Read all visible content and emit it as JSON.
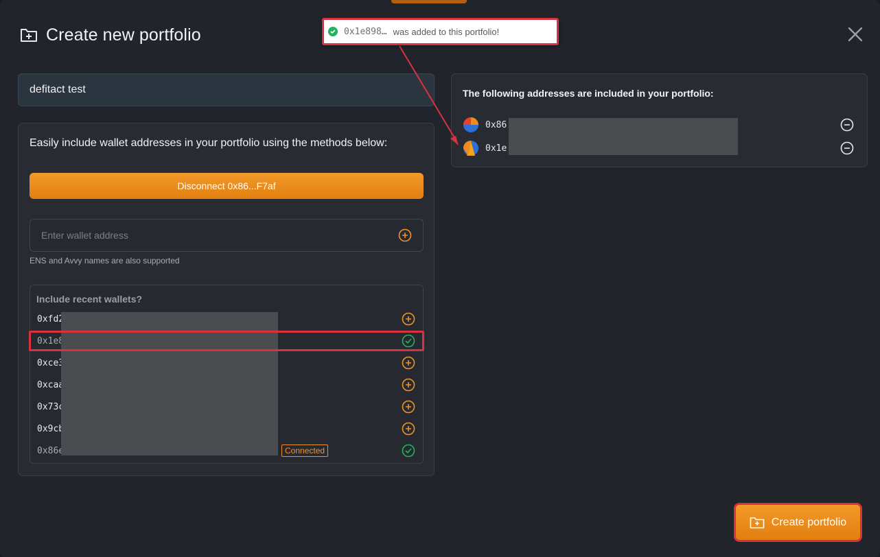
{
  "header": {
    "title": "Create new portfolio",
    "icon": "folder-plus-icon"
  },
  "toast": {
    "address": "0x1e898…",
    "message": "was added to this portfolio!",
    "status_color": "#22b35f"
  },
  "portfolio_name": {
    "value": "defitact test"
  },
  "left": {
    "heading": "Easily include wallet addresses in your portfolio using the methods below:",
    "disconnect_label": "Disconnect 0x86...F7af",
    "wallet_input": {
      "placeholder": "Enter wallet address",
      "value": ""
    },
    "ens_hint": "ENS and Avvy names are also supported",
    "recent": {
      "title": "Include recent wallets?",
      "rows": [
        {
          "address": "0xfd2",
          "state": "add"
        },
        {
          "address": "0x1e8",
          "state": "added"
        },
        {
          "address": "0xce3",
          "state": "add"
        },
        {
          "address": "0xcaa",
          "state": "add"
        },
        {
          "address": "0x73c",
          "state": "add"
        },
        {
          "address": "0x9cb",
          "state": "add"
        },
        {
          "address": "0x86e",
          "state": "added",
          "badge": "Connected"
        }
      ]
    }
  },
  "right": {
    "heading": "The following addresses are included in your portfolio:",
    "addresses": [
      {
        "address": "0x86"
      },
      {
        "address": "0x1e"
      }
    ]
  },
  "create_button": {
    "label": "Create portfolio"
  },
  "colors": {
    "accent": "#f0922a",
    "highlight": "#d8323f",
    "success": "#22b35f"
  }
}
